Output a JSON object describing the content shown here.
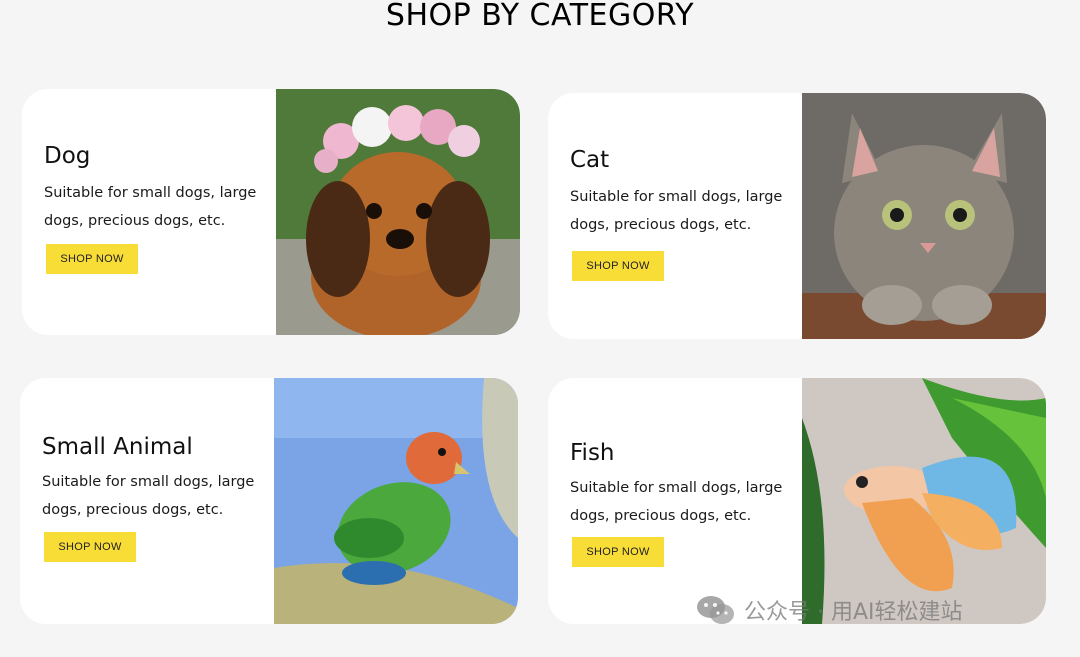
{
  "page": {
    "title": "SHOP BY CATEGORY"
  },
  "categories": [
    {
      "name": "Dog",
      "description": "Suitable for small dogs, large dogs, precious dogs, etc.",
      "button": "SHOP NOW",
      "image": "puppy-with-flower-crown"
    },
    {
      "name": "Cat",
      "description": "Suitable for small dogs, large dogs, precious dogs, etc.",
      "button": "SHOP NOW",
      "image": "tabby-kitten"
    },
    {
      "name": "Small Animal",
      "description": "Suitable for small dogs, large dogs, precious dogs, etc.",
      "button": "SHOP NOW",
      "image": "lovebird-parrot"
    },
    {
      "name": "Fish",
      "description": "Suitable for small dogs, large dogs, precious dogs, etc.",
      "button": "SHOP NOW",
      "image": "betta-fish"
    }
  ],
  "watermark": {
    "text": "公众号 · 用AI轻松建站",
    "icon": "wechat-icon"
  },
  "colors": {
    "button": "#f9dd37",
    "card": "#ffffff",
    "background": "#f5f5f5"
  }
}
